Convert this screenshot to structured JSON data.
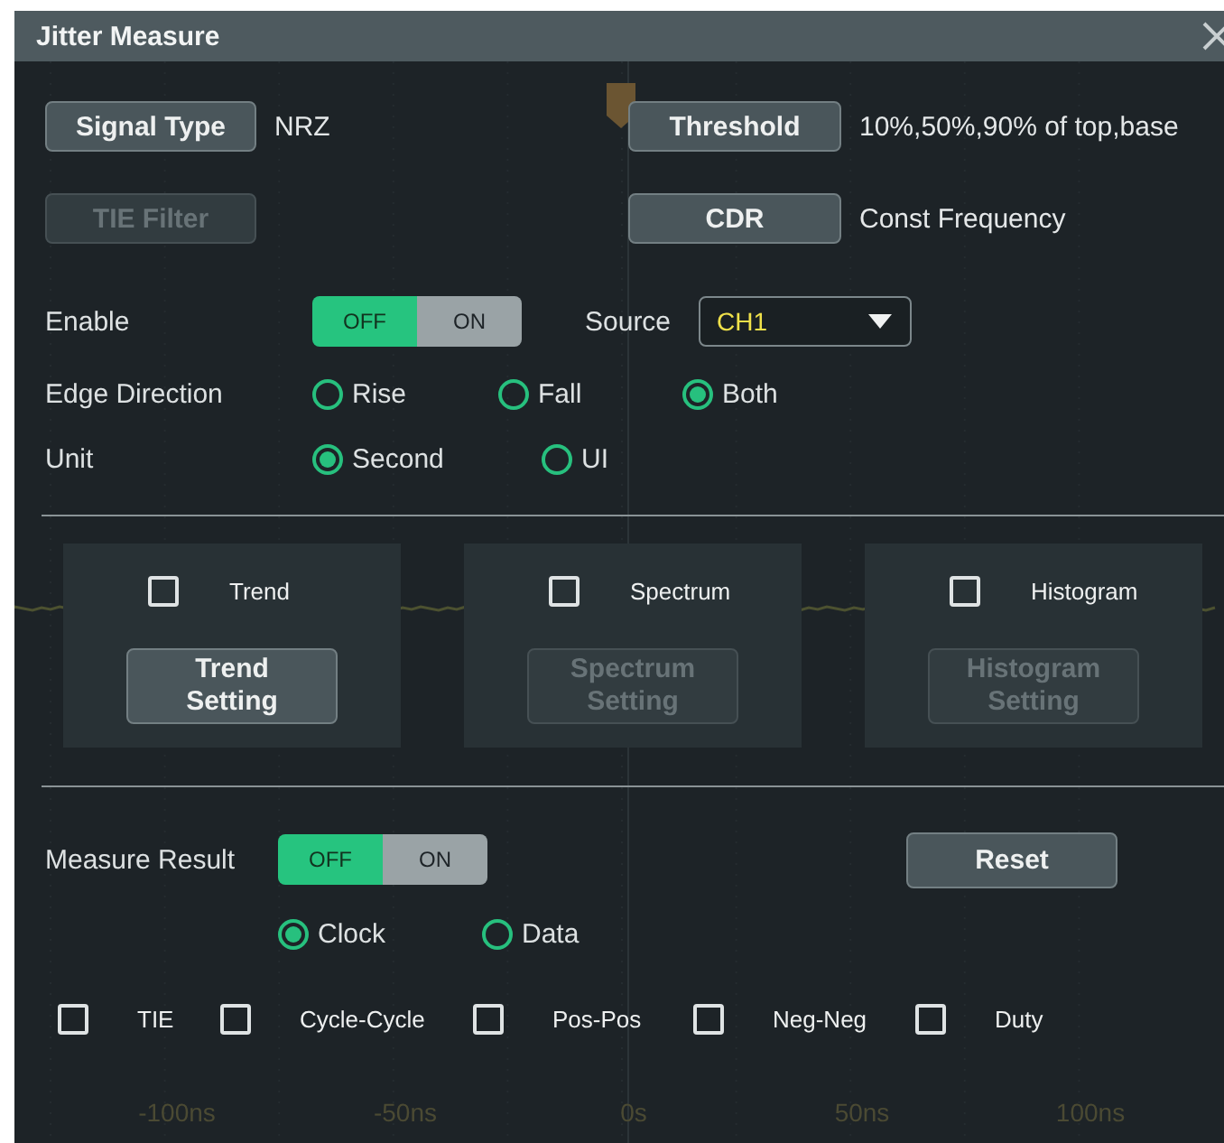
{
  "window": {
    "title": "Jitter Measure"
  },
  "signal_type": {
    "button": "Signal Type",
    "value": "NRZ"
  },
  "threshold": {
    "button": "Threshold",
    "value": "10%,50%,90% of top,base"
  },
  "tie_filter": {
    "button": "TIE Filter",
    "disabled": true
  },
  "cdr": {
    "button": "CDR",
    "value": "Const Frequency"
  },
  "enable": {
    "label": "Enable",
    "options": [
      {
        "label": "OFF",
        "selected": true
      },
      {
        "label": "ON",
        "selected": false
      }
    ]
  },
  "source": {
    "label": "Source",
    "value": "CH1"
  },
  "edge_direction": {
    "label": "Edge Direction",
    "options": [
      {
        "label": "Rise",
        "selected": false
      },
      {
        "label": "Fall",
        "selected": false
      },
      {
        "label": "Both",
        "selected": true
      }
    ]
  },
  "unit": {
    "label": "Unit",
    "options": [
      {
        "label": "Second",
        "selected": true
      },
      {
        "label": "UI",
        "selected": false
      }
    ]
  },
  "views": [
    {
      "label": "Trend",
      "checked": false,
      "button": "Trend Setting",
      "disabled": false
    },
    {
      "label": "Spectrum",
      "checked": false,
      "button": "Spectrum Setting",
      "disabled": true
    },
    {
      "label": "Histogram",
      "checked": false,
      "button": "Histogram Setting",
      "disabled": true
    }
  ],
  "measure_result": {
    "label": "Measure Result",
    "options": [
      {
        "label": "OFF",
        "selected": true
      },
      {
        "label": "ON",
        "selected": false
      }
    ]
  },
  "reset": {
    "button": "Reset"
  },
  "result_type": {
    "options": [
      {
        "label": "Clock",
        "selected": true
      },
      {
        "label": "Data",
        "selected": false
      }
    ]
  },
  "measurements": [
    {
      "label": "TIE",
      "checked": false
    },
    {
      "label": "Cycle-Cycle",
      "checked": false
    },
    {
      "label": "Pos-Pos",
      "checked": false
    },
    {
      "label": "Neg-Neg",
      "checked": false
    },
    {
      "label": "Duty",
      "checked": false
    }
  ],
  "time_axis": {
    "labels": [
      "-100ns",
      "-50ns",
      "0s",
      "50ns",
      "100ns"
    ]
  }
}
